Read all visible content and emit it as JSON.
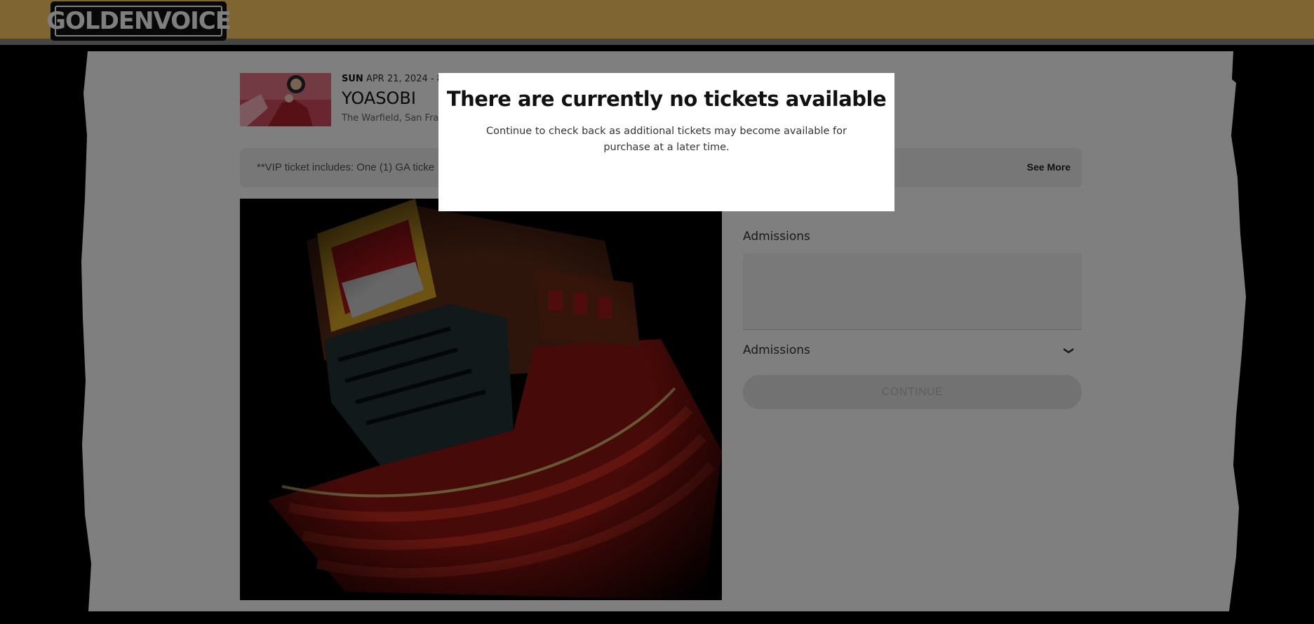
{
  "header": {
    "logo_text": "GOLDENVOICE",
    "background_color": "#fccb62"
  },
  "event": {
    "day": "SUN",
    "date_time": "APR 21, 2024 - 8:",
    "title": "YOASOBI",
    "venue": "The Warfield, San Fran"
  },
  "notice": {
    "text": "**VIP ticket includes: One (1) GA ticke",
    "see_more_label": "See More"
  },
  "venue_map": {
    "icon": "theater-seating-map"
  },
  "tickets": {
    "admissions_label": "Admissions",
    "select_label": "Admissions",
    "continue_label": "CONTINUE"
  },
  "modal": {
    "title": "There are currently no tickets available",
    "body": "Continue to check back as additional tickets may become available for purchase at a later time."
  }
}
